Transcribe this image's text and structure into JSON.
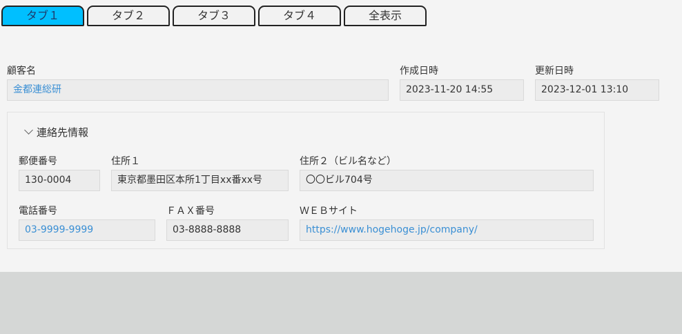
{
  "tabs": [
    {
      "label": "タブ１",
      "active": true
    },
    {
      "label": "タブ２",
      "active": false
    },
    {
      "label": "タブ３",
      "active": false
    },
    {
      "label": "タブ４",
      "active": false
    },
    {
      "label": "全表示",
      "active": false
    }
  ],
  "customer": {
    "label": "顧客名",
    "value": "金都連総研"
  },
  "created": {
    "label": "作成日時",
    "value": "2023-11-20 14:55"
  },
  "updated": {
    "label": "更新日時",
    "value": "2023-12-01 13:10"
  },
  "contact": {
    "header": "連絡先情報",
    "postal": {
      "label": "郵便番号",
      "value": "130-0004"
    },
    "address1": {
      "label": "住所１",
      "value": "東京都墨田区本所1丁目xx番xx号"
    },
    "address2": {
      "label": "住所２（ビル名など）",
      "value": "〇〇ビル704号"
    },
    "phone": {
      "label": "電話番号",
      "value": "03-9999-9999"
    },
    "fax": {
      "label": "ＦＡＸ番号",
      "value": "03-8888-8888"
    },
    "web": {
      "label": "ＷＥＢサイト",
      "value": "https://www.hogehoge.jp/company/"
    }
  },
  "colors": {
    "active_tab": "#00bfff",
    "link": "#3a8fd4",
    "panel_bg": "#f4f4f4",
    "footer_bg": "#d5d7d6"
  }
}
